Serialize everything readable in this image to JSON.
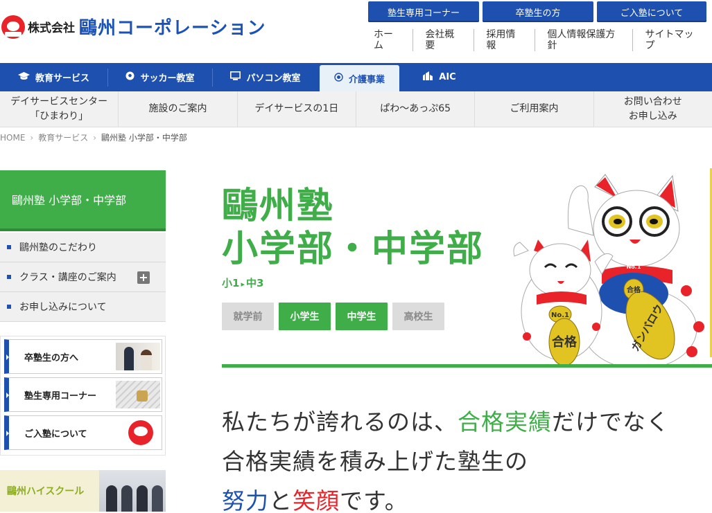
{
  "header": {
    "logo_small": "株式会社",
    "logo_big": "鷗州コーポレーション",
    "top_buttons": [
      "塾生専用コーナー",
      "卒塾生の方",
      "ご入塾について"
    ],
    "util_nav": [
      "ホーム",
      "会社概要",
      "採用情報",
      "個人情報保護方針",
      "サイトマップ"
    ]
  },
  "main_nav": [
    {
      "label": "教育サービス",
      "icon": "graduation-cap-icon"
    },
    {
      "label": "サッカー教室",
      "icon": "soccer-ball-icon"
    },
    {
      "label": "パソコン教室",
      "icon": "monitor-icon"
    },
    {
      "label": "介護事業",
      "icon": "target-icon",
      "active": true
    },
    {
      "label": "AIC",
      "icon": "building-icon"
    }
  ],
  "sub_nav": [
    {
      "line1": "デイサービスセンター",
      "line2": "「ひまわり」"
    },
    {
      "line1": "施設のご案内",
      "line2": ""
    },
    {
      "line1": "デイサービスの1日",
      "line2": ""
    },
    {
      "line1": "ぱわ～あっぷ65",
      "line2": ""
    },
    {
      "line1": "ご利用案内",
      "line2": ""
    },
    {
      "line1": "お問い合わせ",
      "line2": "お申し込み"
    }
  ],
  "breadcrumb": {
    "home": "HOME",
    "level1": "教育サービス",
    "current": "鷗州塾 小学部・中学部"
  },
  "sidebar": {
    "title": "鷗州塾 小学部・中学部",
    "menu": [
      "鷗州塾のこだわり",
      "クラス・講座のご案内",
      "お申し込みについて"
    ],
    "expand_symbol": "+",
    "banners": [
      "卒塾生の方へ",
      "塾生専用コーナー",
      "ご入塾について"
    ],
    "high_school": "鷗州ハイスクール"
  },
  "hero": {
    "title_line1": "鷗州塾",
    "title_line2": "小学部・中学部",
    "grade_from": "小1",
    "grade_arrow": "▸",
    "grade_to": "中3",
    "pills": [
      {
        "label": "就学前",
        "active": false
      },
      {
        "label": "小学生",
        "active": true
      },
      {
        "label": "中学生",
        "active": true
      },
      {
        "label": "高校生",
        "active": false
      }
    ],
    "cat_badges": {
      "shou": "No.1",
      "gokaku_big": "合格",
      "gokaku_small": "合格",
      "no1": "No.1",
      "ganbaro": "ガンバロウ"
    }
  },
  "message": {
    "l1_a": "私たちが誇れるのは、",
    "l1_b": "合格実績",
    "l1_c": "だけでなく",
    "l2": "合格実績を積み上げた塾生の",
    "l3_a": "努力",
    "l3_b": "と",
    "l3_c": "笑顔",
    "l3_d": "です。"
  },
  "colors": {
    "brand_blue": "#1e50b0",
    "brand_green": "#3fae49",
    "accent_red": "#e8242a"
  }
}
